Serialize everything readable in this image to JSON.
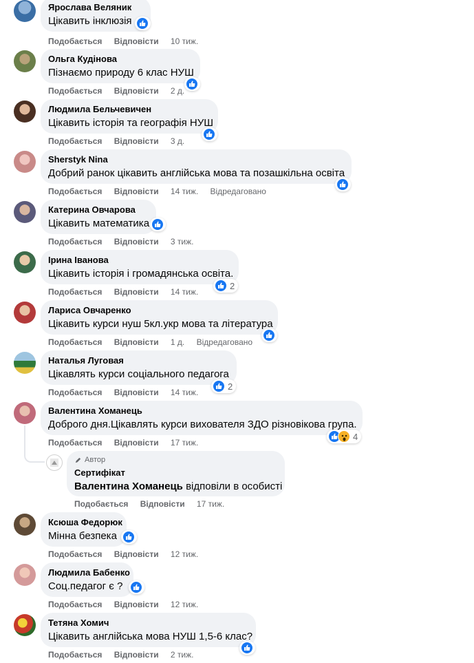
{
  "labels": {
    "like": "Подобається",
    "reply": "Відповісти",
    "edited": "Відредаговано",
    "author_badge": "Автор"
  },
  "comments": [
    {
      "author": "Ярослава Веляник",
      "text": "Цікавить інклюзія",
      "time": "10 тиж.",
      "reactions": {
        "like": true
      }
    },
    {
      "author": "Ольга Кудінова",
      "text": "Пізнаємо природу 6 клас НУШ",
      "time": "2 д.",
      "reactions": {
        "like": true
      }
    },
    {
      "author": "Людмила Бельчевичен",
      "text": "Цікавить історія та географія НУШ",
      "time": "3 д.",
      "reactions": {
        "like": true
      }
    },
    {
      "author": "Sherstyk Nina",
      "text": "Добрий ранок цікавить англійська мова та позашкільна освіта",
      "time": "14 тиж.",
      "edited": true,
      "reactions": {
        "like": true
      }
    },
    {
      "author": "Катерина Овчарова",
      "text": "Цікавить математика",
      "time": "3 тиж.",
      "reactions": {
        "like": true
      }
    },
    {
      "author": "Ірина Іванова",
      "text": "Цікавить історія і громадянська освіта.",
      "time": "14 тиж.",
      "reactions": {
        "like": true,
        "count": "2"
      }
    },
    {
      "author": "Лариса Овчаренко",
      "text": "Цікавить курси нуш 5кл.укр мова та література",
      "time": "1 д.",
      "edited": true,
      "reactions": {
        "like": true
      }
    },
    {
      "author": "Наталья Луговая",
      "text": "Цікавлять курси соціального педагога",
      "time": "14 тиж.",
      "reactions": {
        "like": true,
        "count": "2"
      }
    },
    {
      "author": "Валентина Хоманець",
      "text": "Доброго дня.Цікавлять курси вихователя ЗДО різновікова група.",
      "time": "17 тиж.",
      "reactions": {
        "like": true,
        "wow": true,
        "count": "4"
      }
    },
    {
      "author": "Ксюша Федорюк",
      "text": "Мінна безпека",
      "time": "12 тиж.",
      "reactions": {
        "like": true
      }
    },
    {
      "author": "Людмила Бабенко",
      "text": "Соц.педагог є ?",
      "time": "12 тиж.",
      "reactions": {
        "like": true
      }
    },
    {
      "author": "Тетяна Хомич",
      "text": "Цікавить англійська мова НУШ 1,5-6 клас?",
      "time": "2 тиж.",
      "reactions": {
        "like": true
      }
    }
  ],
  "reply": {
    "author": "Сертифікат",
    "mention": "Валентина Хоманець",
    "text": " відповіли в особисті",
    "time": "17 тиж."
  },
  "colors": {
    "bubble": "#f0f2f5",
    "meta": "#65676b",
    "like": "#1877f2",
    "wow": "#f7b125"
  }
}
